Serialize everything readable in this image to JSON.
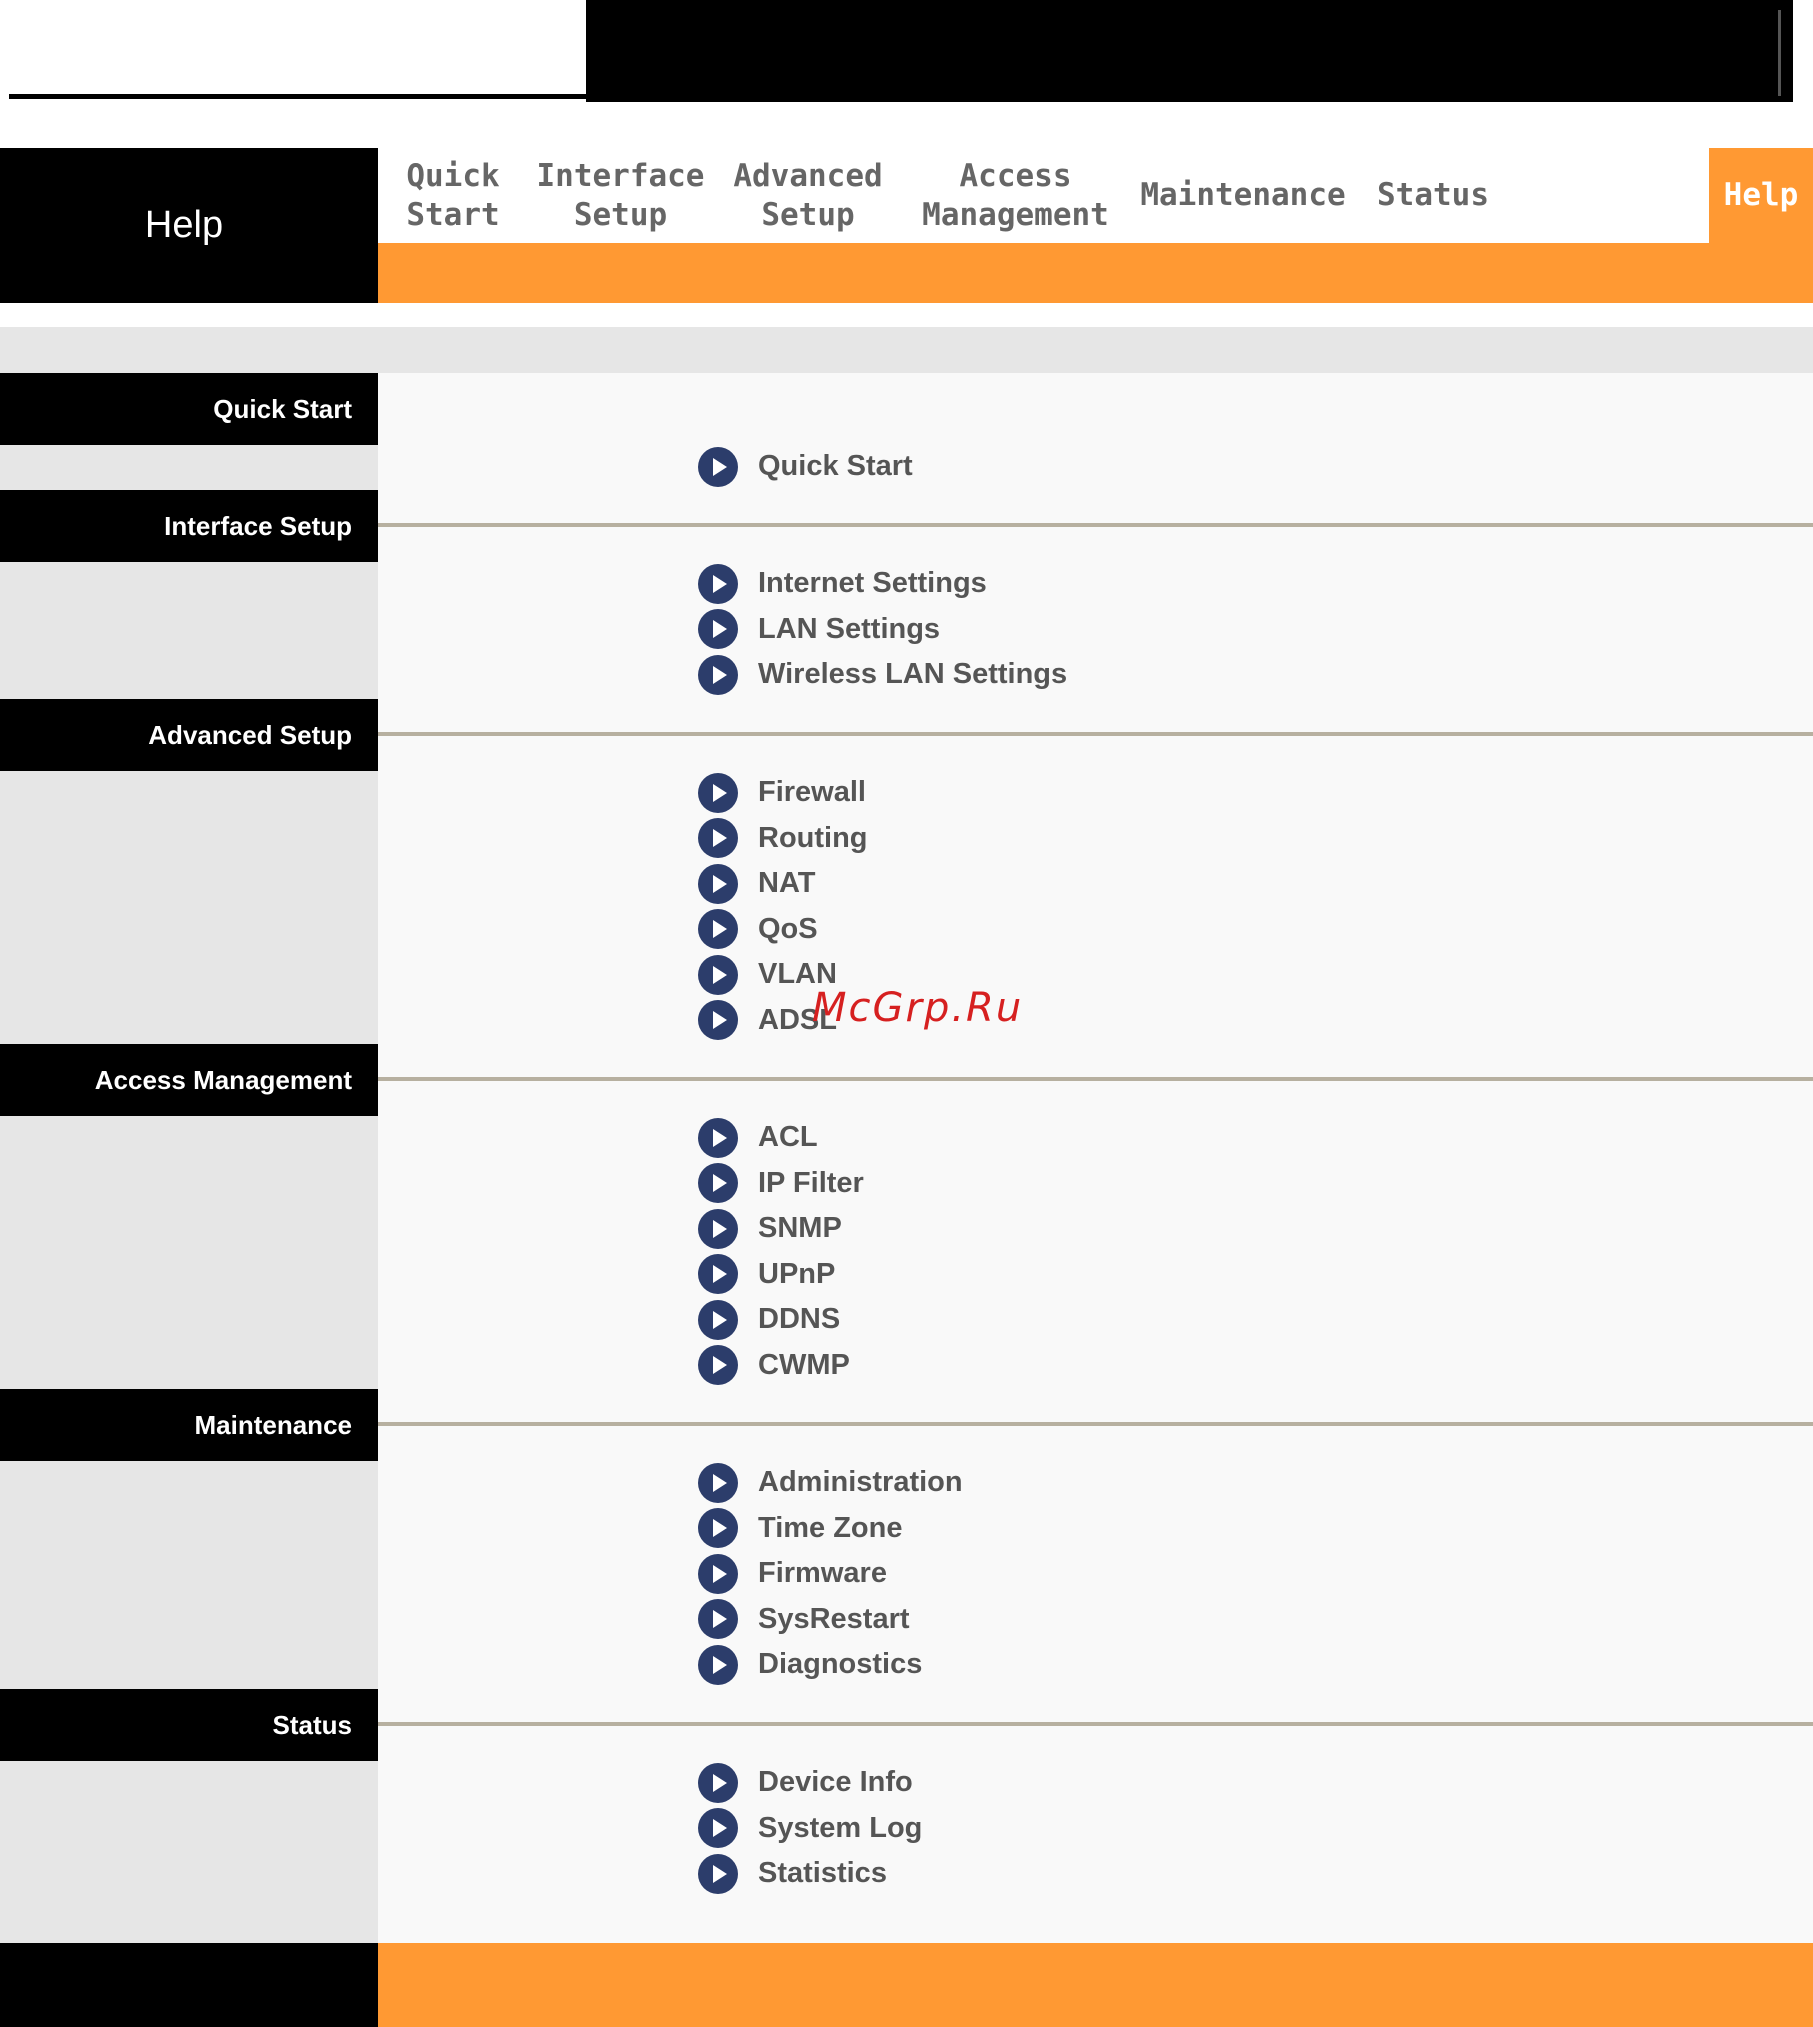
{
  "header": {
    "title": "Help",
    "nav": [
      {
        "label": "Quick\nStart",
        "active": false
      },
      {
        "label": "Interface\nSetup",
        "active": false
      },
      {
        "label": "Advanced\nSetup",
        "active": false
      },
      {
        "label": "Access\nManagement",
        "active": false
      },
      {
        "label": "Maintenance",
        "active": false
      },
      {
        "label": "Status",
        "active": false
      },
      {
        "label": "Help",
        "active": true
      }
    ]
  },
  "sections": [
    {
      "title": "Quick Start",
      "links": [
        "Quick Start"
      ]
    },
    {
      "title": "Interface Setup",
      "links": [
        "Internet Settings",
        "LAN Settings",
        "Wireless LAN Settings"
      ]
    },
    {
      "title": "Advanced Setup",
      "links": [
        "Firewall",
        "Routing",
        "NAT",
        "QoS",
        "VLAN",
        "ADSL"
      ]
    },
    {
      "title": "Access Management",
      "links": [
        "ACL",
        "IP Filter",
        "SNMP",
        "UPnP",
        "DDNS",
        "CWMP"
      ]
    },
    {
      "title": "Maintenance",
      "links": [
        "Administration",
        "Time Zone",
        "Firmware",
        "SysRestart",
        "Diagnostics"
      ]
    },
    {
      "title": "Status",
      "links": [
        "Device Info",
        "System Log",
        "Statistics"
      ]
    }
  ],
  "watermark": "McGrp.Ru",
  "colors": {
    "accent": "#ff9933",
    "bullet": "#2c3d6b",
    "sidebar": "#e6e6e6",
    "separator": "#b7b0a0"
  }
}
